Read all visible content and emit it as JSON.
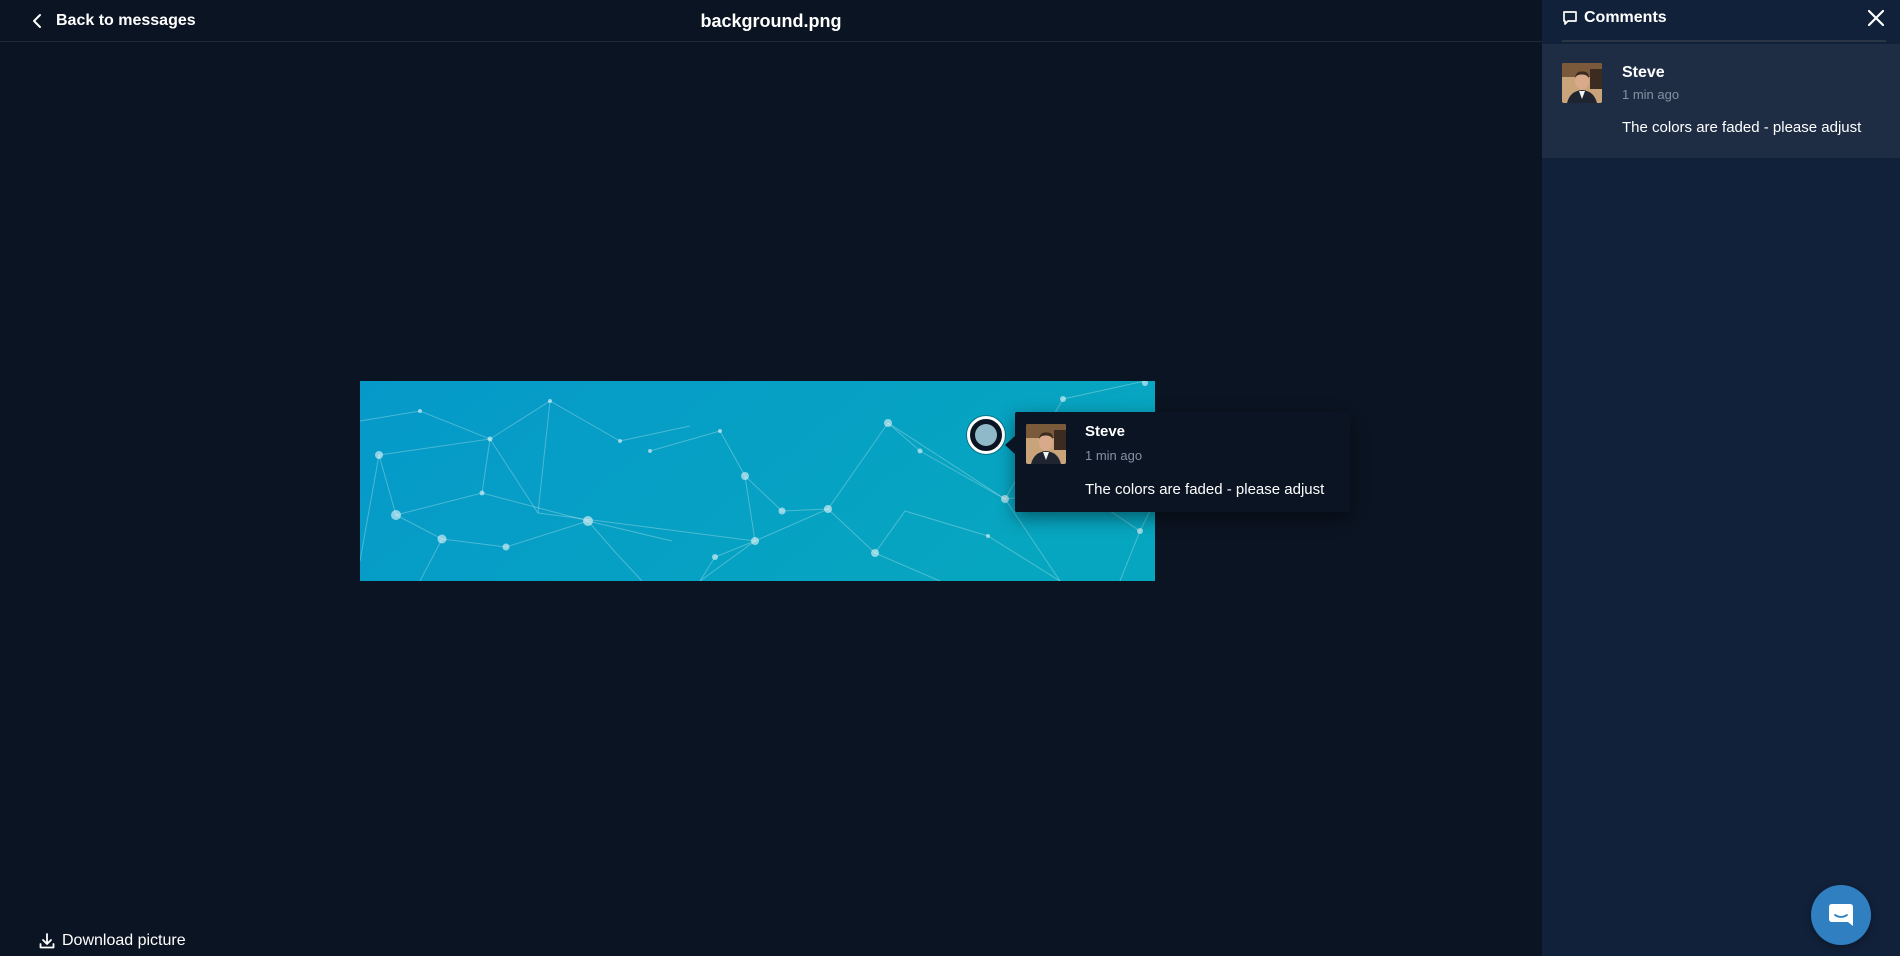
{
  "header": {
    "back_label": "Back to messages",
    "file_name": "background.png"
  },
  "viewer": {
    "download_label": "Download picture"
  },
  "pin_comment": {
    "author": "Steve",
    "time": "1 min ago",
    "text": "The colors are faded - please adjust"
  },
  "panel": {
    "title": "Comments",
    "comments": [
      {
        "author": "Steve",
        "time": "1 min ago",
        "text": "The colors are faded - please adjust"
      }
    ]
  },
  "icons": {
    "back": "chevron-left-icon",
    "download": "download-icon",
    "comments": "comment-icon",
    "close": "close-icon",
    "chat": "chat-icon"
  },
  "colors": {
    "background": "#0b1422",
    "panel": "#11213a",
    "card": "#1e2d44",
    "image_start": "#0599c9",
    "image_end": "#07a6c0",
    "accent": "#2f7fc1",
    "muted_text": "#8391a2"
  }
}
